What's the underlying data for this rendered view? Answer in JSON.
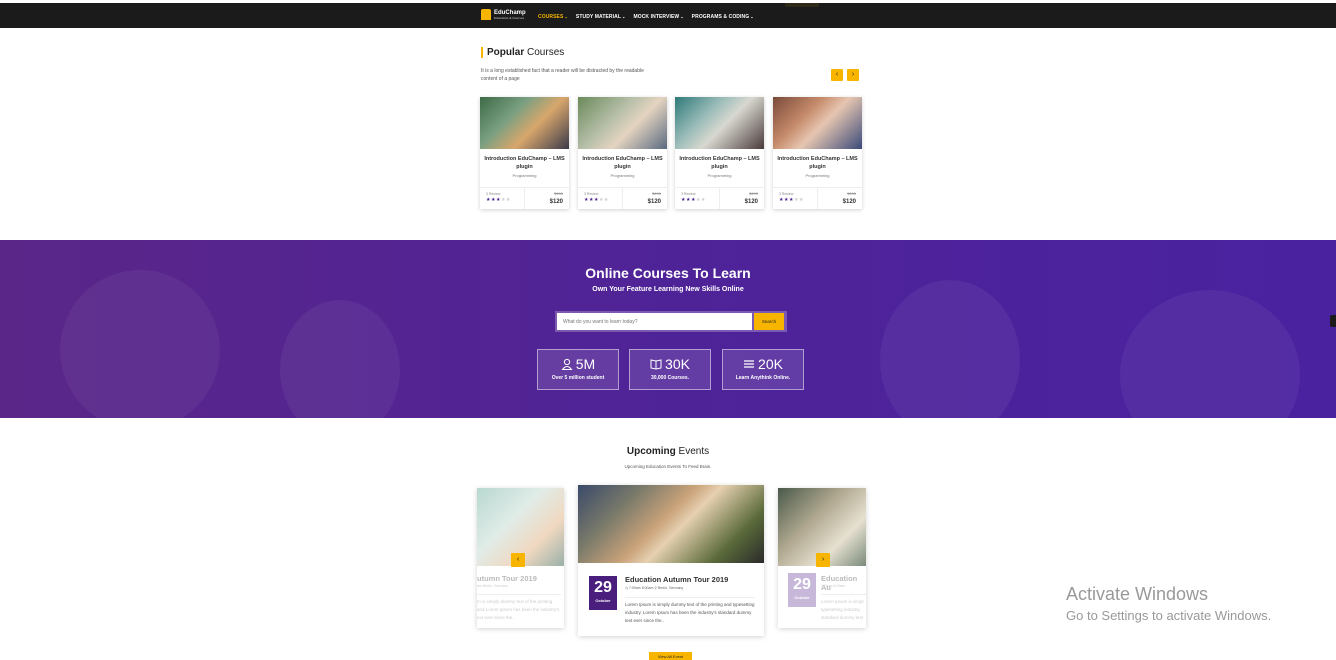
{
  "nav": {
    "brand": "EduChamp",
    "brand_sub": "Education & Courses",
    "items": [
      {
        "label": "COURSES"
      },
      {
        "label": "STUDY MATERIAL"
      },
      {
        "label": "MOCK INTERVIEW"
      },
      {
        "label": "PROGRAMS & CODING"
      }
    ]
  },
  "popular": {
    "title_bold": "Popular",
    "title_rest": " Courses",
    "description": "It is a long established fact that a reader will be distracted by the readable content of a page",
    "prev_icon": "‹",
    "next_icon": "›",
    "courses": [
      {
        "title": "Introduction EduChamp – LMS plugin",
        "category": "Programming",
        "reviews": "3 Review",
        "old_price": "$190",
        "price": "$120",
        "rating": 3
      },
      {
        "title": "Introduction EduChamp – LMS plugin",
        "category": "Programming",
        "reviews": "3 Review",
        "old_price": "$190",
        "price": "$120",
        "rating": 3
      },
      {
        "title": "Introduction EduChamp – LMS plugin",
        "category": "Programming",
        "reviews": "3 Review",
        "old_price": "$190",
        "price": "$120",
        "rating": 3
      },
      {
        "title": "Introduction EduChamp – LMS plugin",
        "category": "Programming",
        "reviews": "3 Review",
        "old_price": "$190",
        "price": "$120",
        "rating": 3
      }
    ]
  },
  "banner": {
    "title": "Online Courses To Learn",
    "subtitle": "Own Your Feature Learning New Skills Online",
    "search_placeholder": "What do you want to learn today?",
    "search_button": "Search",
    "stats": [
      {
        "value": "5M",
        "label": "Over 5 million student",
        "icon": "user-icon"
      },
      {
        "value": "30K",
        "label": "30,000 Courses.",
        "icon": "book-icon"
      },
      {
        "value": "20K",
        "label": "Learn Anythink Online.",
        "icon": "list-icon"
      }
    ]
  },
  "events": {
    "title_bold": "Upcoming",
    "title_rest": " Events",
    "subtitle": "Upcoming Education Events To Feed Brain.",
    "items": [
      {
        "day": "29",
        "month": "October",
        "name": "Education Autumn Tour 2019",
        "time": "7:00am 8:00am",
        "location": "Berlin, Germany",
        "text": "Lorem Ipsum is simply dummy text of the printing and typesetting industry. Lorem Ipsum has been the industry's standard dummy text ever since the.."
      }
    ],
    "left_name": "utumn Tour 2019",
    "left_meta": "am    Berlin, Germany",
    "left_text": "m is simply dummy text of the printing and Lorem Ipsum has been the industry's ext ever since the..",
    "right_day": "29",
    "right_month": "October",
    "right_name": "Education Au",
    "right_meta": "7:00am 8:00am",
    "right_text": "Lorem Ipsum is simpl typesetting industry. standard dummy text",
    "view_all": "View All Event"
  },
  "watermark": {
    "line1": "Activate Windows",
    "line2": "Go to Settings to activate Windows."
  }
}
